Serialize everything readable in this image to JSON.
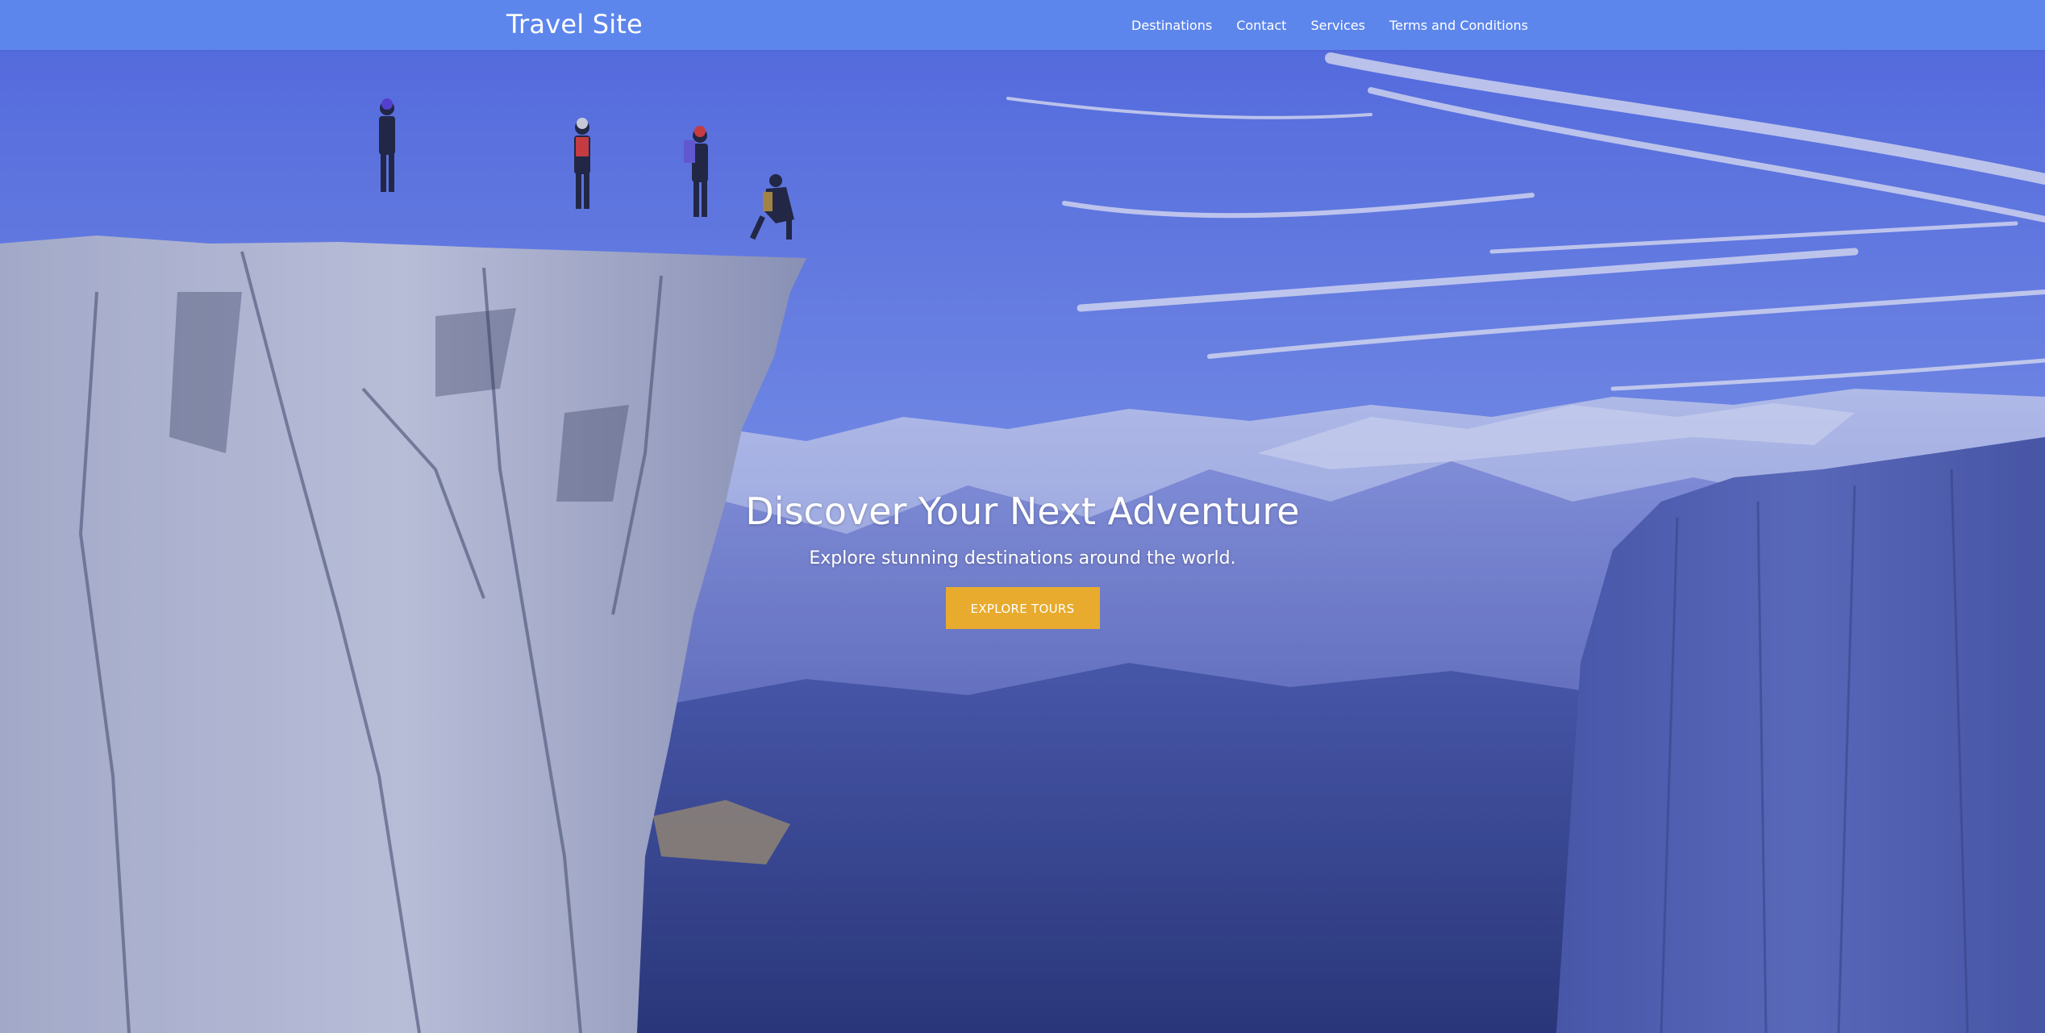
{
  "navbar": {
    "brand": "Travel Site",
    "links": [
      {
        "label": "Destinations"
      },
      {
        "label": "Contact"
      },
      {
        "label": "Services"
      },
      {
        "label": "Terms and Conditions"
      }
    ],
    "background_color": "#5d86ec"
  },
  "hero": {
    "title": "Discover Your Next Adventure",
    "subtitle": "Explore stunning destinations around the world.",
    "cta_label": "EXPLORE TOURS",
    "cta_color": "#e8ab2e",
    "image_subject": "climbers-on-granite-cliff-over-mountain-valley"
  }
}
